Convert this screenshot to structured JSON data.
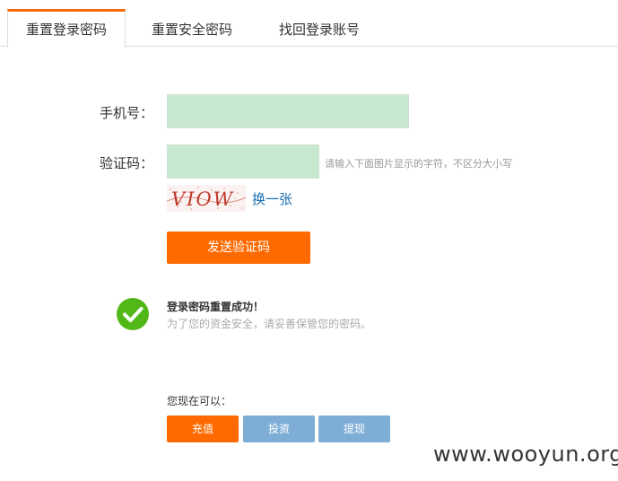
{
  "tabs": [
    {
      "label": "重置登录密码",
      "active": true
    },
    {
      "label": "重置安全密码",
      "active": false
    },
    {
      "label": "找回登录账号",
      "active": false
    }
  ],
  "form": {
    "phone_label": "手机号：",
    "phone_value": "",
    "code_label": "验证码：",
    "code_value": "",
    "code_hint": "请输入下面图片显示的字符，不区分大小写",
    "captcha_text": "VIOW",
    "refresh_label": "换一张",
    "send_button": "发送验证码"
  },
  "result": {
    "title": "登录密码重置成功！",
    "subtitle": "为了您的资金安全，请妥善保管您的密码。"
  },
  "actions": {
    "label": "您现在可以：",
    "buttons": [
      "充值",
      "投资",
      "提现"
    ]
  },
  "watermark": "www.wooyun.org",
  "colors": {
    "accent": "#ff6a00",
    "secondary": "#7eaed6",
    "input_bg": "#c8e9cf",
    "success": "#52b818",
    "link": "#1a6fb0"
  }
}
